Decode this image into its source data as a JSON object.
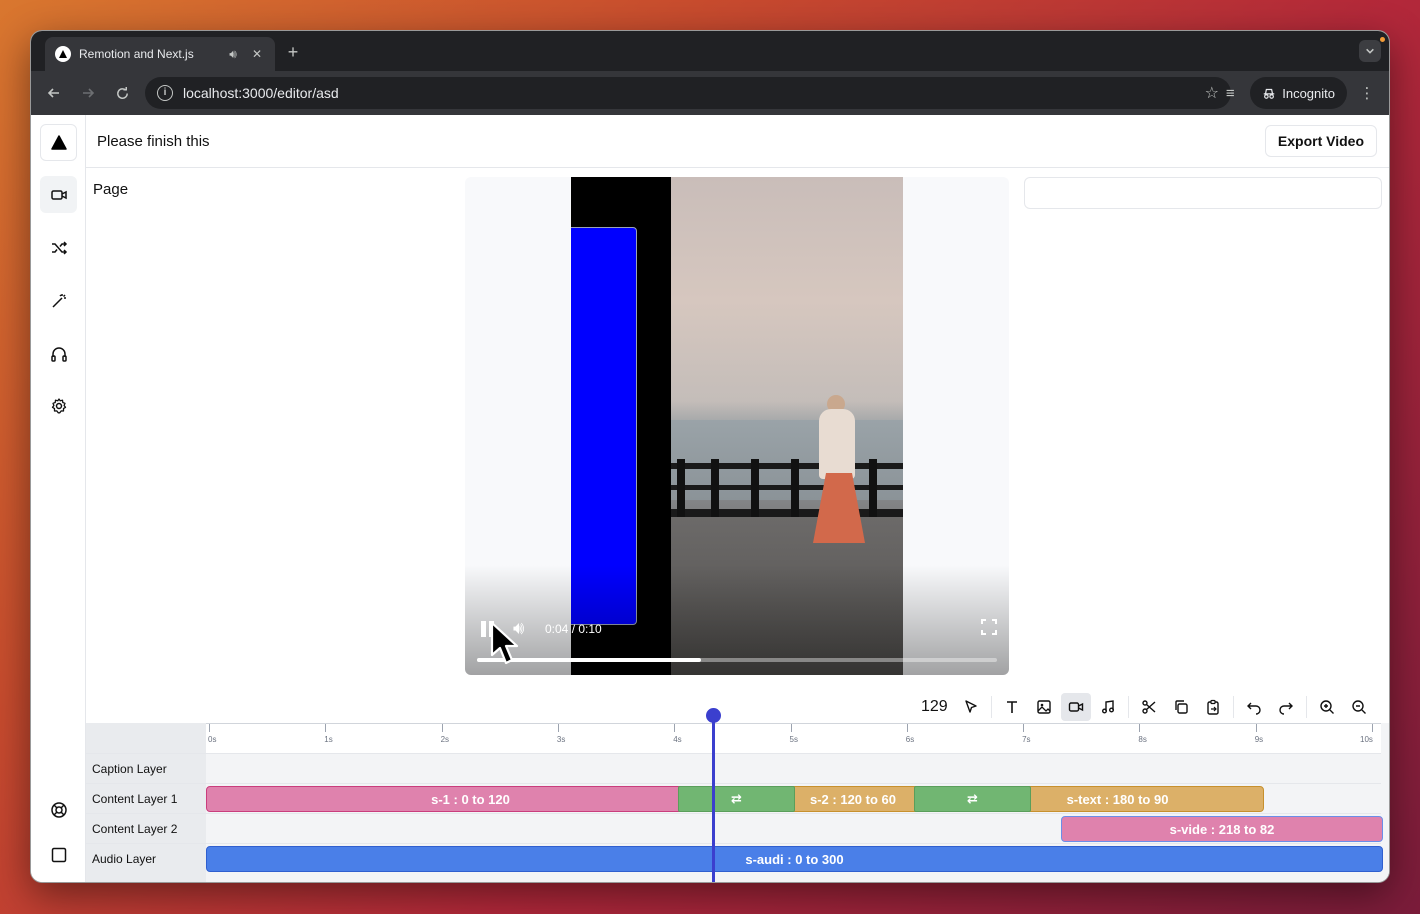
{
  "browser": {
    "tab_title": "Remotion and Next.js",
    "url": "localhost:3000/editor/asd",
    "incognito_label": "Incognito"
  },
  "header": {
    "title": "Please finish this",
    "export_label": "Export Video"
  },
  "section": {
    "title": "Page"
  },
  "player": {
    "time": "0:04 / 0:10",
    "progress": 0.43
  },
  "toolbar": {
    "frame": "129"
  },
  "timeline": {
    "ticks": [
      "0s",
      "1s",
      "2s",
      "3s",
      "4s",
      "5s",
      "6s",
      "7s",
      "8s",
      "9s",
      "10s"
    ],
    "tracks": [
      {
        "label": "Caption Layer"
      },
      {
        "label": "Content Layer 1"
      },
      {
        "label": "Content Layer 2"
      },
      {
        "label": "Audio Layer"
      }
    ],
    "clips": {
      "s1": "s-1 : 0 to 120",
      "s2": "s-2 : 120 to 60",
      "stext": "s-text : 180 to 90",
      "svide": "s-vide : 218 to 82",
      "saudi": "s-audi : 0 to 300",
      "transition": "⇄"
    }
  },
  "colors": {
    "accent": "#3b3fce",
    "clip_pink": "#df82ad",
    "clip_tan": "#dcb068",
    "clip_green": "#71b672",
    "clip_blue": "#4a7fe8"
  }
}
